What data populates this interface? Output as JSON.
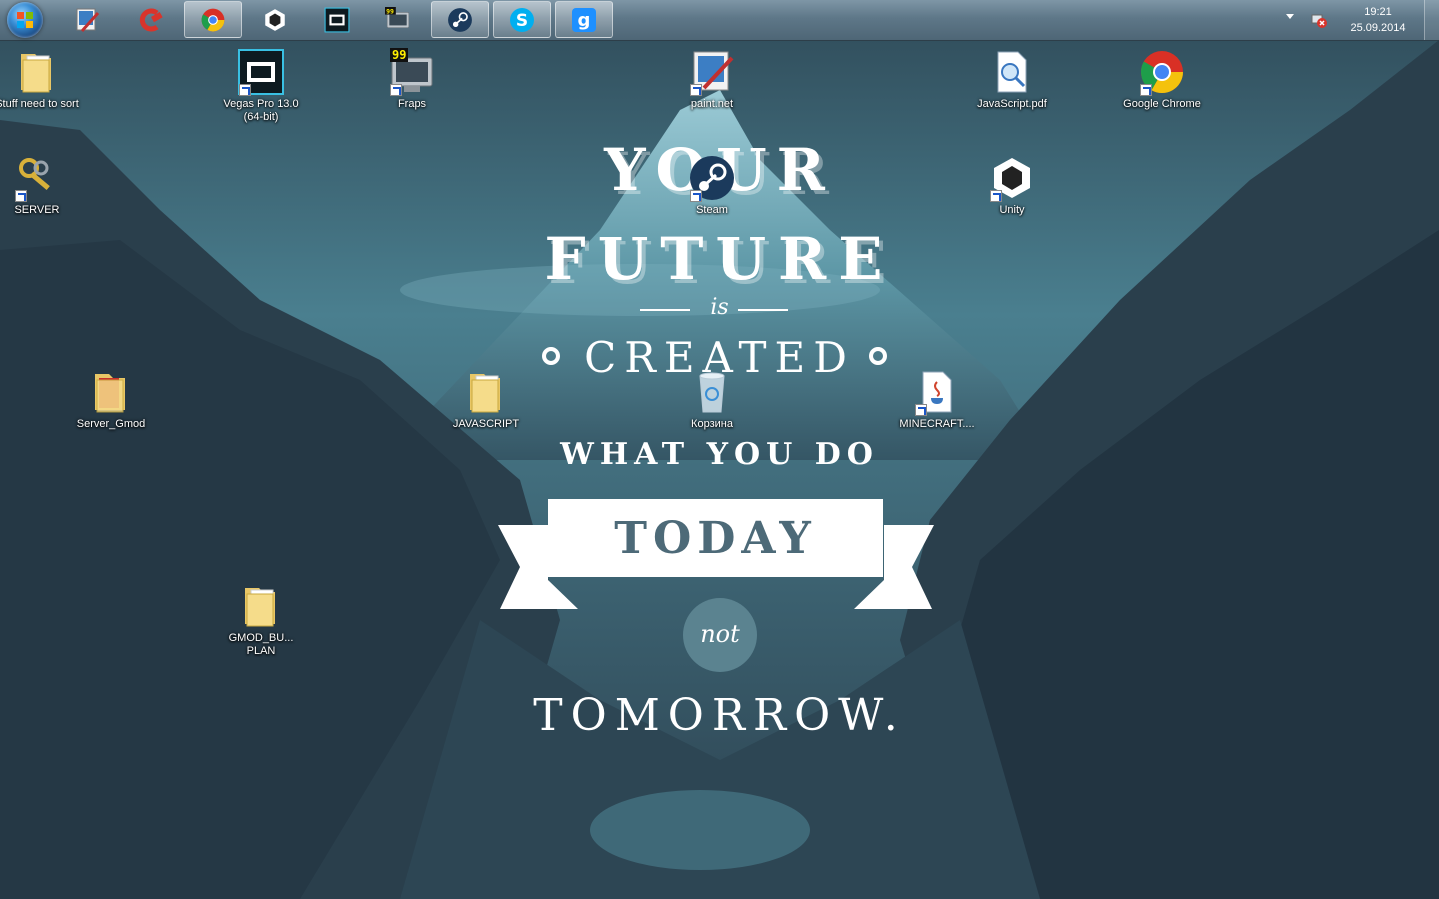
{
  "taskbar": {
    "start": "Start",
    "pinned": [
      {
        "name": "paint.net",
        "icon": "paintnet-icon"
      },
      {
        "name": "CCleaner",
        "icon": "ccleaner-icon"
      },
      {
        "name": "Google Chrome",
        "icon": "chrome-icon"
      },
      {
        "name": "Unity",
        "icon": "unity-icon"
      },
      {
        "name": "Vegas Pro",
        "icon": "vegas-icon"
      },
      {
        "name": "Fraps",
        "icon": "fraps-icon"
      },
      {
        "name": "Steam",
        "icon": "steam-icon"
      },
      {
        "name": "Skype",
        "icon": "skype-icon"
      },
      {
        "name": "Garry's Mod",
        "icon": "gmod-icon"
      }
    ],
    "clock": {
      "time": "19:21",
      "date": "25.09.2014"
    }
  },
  "desktop": {
    "icons": {
      "stuff": "Stuff need to sort",
      "server": "SERVER",
      "vegas": "Vegas Pro 13.0 (64-bit)",
      "fraps": "Fraps",
      "paintnet": "paint.net",
      "steam": "Steam",
      "javascript_pdf": "JavaScript.pdf",
      "chrome": "Google Chrome",
      "unity": "Unity",
      "server_gmod": "Server_Gmod",
      "javascript_folder": "JAVASCRIPT",
      "recycle": "Корзина",
      "minecraft": "MINECRAFT....",
      "gmod_plan": "GMOD_BU... PLAN"
    },
    "fraps_badge": "99"
  },
  "wallpaper": {
    "line1": "YOUR",
    "line2": "FUTURE",
    "line3": "is",
    "line4": "CREATED",
    "line5": "WHAT YOU DO",
    "line6": "TODAY",
    "line7": "not",
    "line8": "TOMORROW.",
    "colors": {
      "sky": "#3d6a7a",
      "mountain_dark": "#243744",
      "banner_text": "#4d6a78",
      "circle": "#5b8390"
    }
  }
}
